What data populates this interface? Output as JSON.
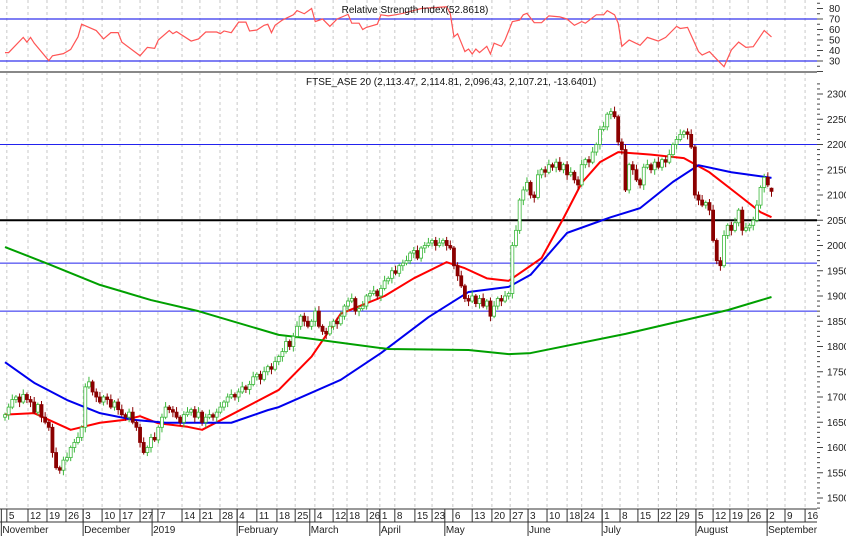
{
  "chart_data": {
    "type": "candlestick",
    "instrument_title": "FTSE_ASE 20 (2,113.47, 2,114.81, 2,096.43, 2,107.21, -13.6401)",
    "price": {
      "ylim": [
        1480,
        2330
      ],
      "yticks": [
        1500,
        1550,
        1600,
        1650,
        1700,
        1750,
        1800,
        1850,
        1900,
        1950,
        2000,
        2050,
        2100,
        2150,
        2200,
        2250,
        2300
      ],
      "closes": [
        1665,
        1680,
        1695,
        1700,
        1690,
        1705,
        1695,
        1690,
        1670,
        1685,
        1660,
        1650,
        1640,
        1590,
        1560,
        1555,
        1575,
        1580,
        1600,
        1610,
        1620,
        1640,
        1720,
        1730,
        1710,
        1700,
        1690,
        1700,
        1695,
        1680,
        1690,
        1675,
        1665,
        1660,
        1670,
        1650,
        1640,
        1610,
        1590,
        1600,
        1620,
        1615,
        1640,
        1660,
        1680,
        1675,
        1670,
        1660,
        1650,
        1665,
        1670,
        1675,
        1660,
        1670,
        1650,
        1660,
        1665,
        1660,
        1670,
        1680,
        1690,
        1700,
        1705,
        1700,
        1710,
        1720,
        1715,
        1725,
        1740,
        1745,
        1735,
        1750,
        1760,
        1755,
        1770,
        1780,
        1790,
        1810,
        1800,
        1820,
        1840,
        1860,
        1850,
        1840,
        1850,
        1870,
        1840,
        1830,
        1825,
        1840,
        1850,
        1845,
        1860,
        1880,
        1890,
        1895,
        1870,
        1875,
        1880,
        1900,
        1905,
        1910,
        1900,
        1915,
        1930,
        1935,
        1950,
        1945,
        1960,
        1965,
        1970,
        1985,
        1990,
        1975,
        1995,
        2000,
        2005,
        2010,
        2000,
        2005,
        2010,
        2000,
        1995,
        1960,
        1940,
        1920,
        1895,
        1890,
        1900,
        1885,
        1895,
        1880,
        1890,
        1860,
        1880,
        1895,
        1890,
        1900,
        1905,
        2000,
        2030,
        2090,
        2110,
        2125,
        2100,
        2095,
        2140,
        2150,
        2145,
        2160,
        2155,
        2165,
        2150,
        2160,
        2140,
        2145,
        2130,
        2120,
        2160,
        2170,
        2165,
        2185,
        2200,
        2230,
        2235,
        2260,
        2265,
        2255,
        2205,
        2190,
        2110,
        2160,
        2150,
        2130,
        2120,
        2155,
        2160,
        2150,
        2165,
        2155,
        2170,
        2165,
        2180,
        2200,
        2210,
        2220,
        2225,
        2220,
        2195,
        2100,
        2090,
        2080,
        2085,
        2070,
        2010,
        1970,
        1960,
        2020,
        2040,
        2030,
        2045,
        2070,
        2030,
        2035,
        2040,
        2050,
        2080,
        2115,
        2135,
        2120,
        2107.21
      ],
      "last_bar": {
        "open": 2113.47,
        "high": 2114.81,
        "low": 2096.43,
        "close": 2107.21,
        "change": -13.6401
      },
      "up_color": "#3cb83c",
      "down_color": "#8b0000"
    },
    "moving_averages": [
      {
        "name": "short-ma",
        "color": "#ff0000",
        "points": [
          [
            0,
            1665
          ],
          [
            8,
            1668
          ],
          [
            18,
            1635
          ],
          [
            26,
            1649
          ],
          [
            33,
            1655
          ],
          [
            37,
            1662
          ],
          [
            42,
            1648
          ],
          [
            50,
            1641
          ],
          [
            54,
            1635
          ],
          [
            62,
            1665
          ],
          [
            75,
            1714
          ],
          [
            84,
            1780
          ],
          [
            92,
            1865
          ],
          [
            104,
            1900
          ],
          [
            112,
            1935
          ],
          [
            121,
            1967
          ],
          [
            126,
            1955
          ],
          [
            132,
            1935
          ],
          [
            138,
            1930
          ],
          [
            147,
            1975
          ],
          [
            153,
            2054
          ],
          [
            158,
            2124
          ],
          [
            163,
            2165
          ],
          [
            168,
            2185
          ],
          [
            177,
            2180
          ],
          [
            186,
            2173
          ],
          [
            193,
            2145
          ],
          [
            201,
            2100
          ],
          [
            207,
            2066
          ],
          [
            210,
            2056
          ]
        ]
      },
      {
        "name": "medium-ma",
        "color": "#0000ee",
        "points": [
          [
            0,
            1769
          ],
          [
            8,
            1728
          ],
          [
            17,
            1694
          ],
          [
            26,
            1668
          ],
          [
            35,
            1655
          ],
          [
            44,
            1649
          ],
          [
            62,
            1649
          ],
          [
            72,
            1674
          ],
          [
            75,
            1680
          ],
          [
            92,
            1734
          ],
          [
            103,
            1787
          ],
          [
            116,
            1858
          ],
          [
            127,
            1908
          ],
          [
            138,
            1918
          ],
          [
            144,
            1942
          ],
          [
            154,
            2025
          ],
          [
            166,
            2056
          ],
          [
            174,
            2074
          ],
          [
            183,
            2126
          ],
          [
            190,
            2159
          ],
          [
            199,
            2145
          ],
          [
            210,
            2134
          ]
        ]
      },
      {
        "name": "long-ma",
        "color": "#00a000",
        "points": [
          [
            0,
            1997
          ],
          [
            12,
            1963
          ],
          [
            26,
            1922
          ],
          [
            40,
            1892
          ],
          [
            53,
            1870
          ],
          [
            75,
            1823
          ],
          [
            82,
            1817
          ],
          [
            105,
            1795
          ],
          [
            127,
            1793
          ],
          [
            138,
            1785
          ],
          [
            144,
            1787
          ],
          [
            170,
            1825
          ],
          [
            198,
            1872
          ],
          [
            210,
            1898
          ]
        ]
      }
    ],
    "hlines": [
      {
        "value": 2200,
        "color": "#2222ee"
      },
      {
        "value": 2050,
        "color": "#000000"
      },
      {
        "value": 1965,
        "color": "#2222ee"
      },
      {
        "value": 1870,
        "color": "#2222ee"
      }
    ],
    "rsi": {
      "title": "Relative Strength Index(52.8618)",
      "value": 52.8618,
      "ylim": [
        15,
        87
      ],
      "ticks": [
        30,
        40,
        50,
        60,
        70,
        80
      ],
      "levels": [
        70,
        30
      ],
      "color": "#ff5555",
      "points": [
        [
          0,
          38
        ],
        [
          1,
          38
        ],
        [
          5,
          52.5
        ],
        [
          6,
          48
        ],
        [
          7,
          52.5
        ],
        [
          8,
          47
        ],
        [
          12,
          30.3
        ],
        [
          13,
          35
        ],
        [
          16,
          37
        ],
        [
          18,
          41
        ],
        [
          20,
          53
        ],
        [
          21,
          65
        ],
        [
          25,
          59
        ],
        [
          27,
          51
        ],
        [
          29,
          57
        ],
        [
          31,
          57
        ],
        [
          32,
          48
        ],
        [
          37,
          35
        ],
        [
          39,
          43
        ],
        [
          41,
          42
        ],
        [
          42,
          50
        ],
        [
          45,
          59
        ],
        [
          46,
          56
        ],
        [
          47,
          58
        ],
        [
          51,
          49
        ],
        [
          53,
          51
        ],
        [
          55,
          57.6
        ],
        [
          58,
          57.6
        ],
        [
          59,
          56
        ],
        [
          60,
          58.6
        ],
        [
          62,
          57
        ],
        [
          64,
          67
        ],
        [
          66,
          67
        ],
        [
          67,
          58.6
        ],
        [
          69,
          59.5
        ],
        [
          71,
          64
        ],
        [
          72,
          65
        ],
        [
          73,
          57
        ],
        [
          74,
          64
        ],
        [
          76,
          69
        ],
        [
          79,
          74
        ],
        [
          80,
          78
        ],
        [
          82,
          75
        ],
        [
          84,
          80
        ],
        [
          85,
          67.5
        ],
        [
          87,
          70
        ],
        [
          89,
          63
        ],
        [
          91,
          70
        ],
        [
          94,
          74.4
        ],
        [
          95,
          66
        ],
        [
          97,
          66
        ],
        [
          98,
          60
        ],
        [
          99,
          62
        ],
        [
          102,
          65
        ],
        [
          103,
          74
        ],
        [
          105,
          73
        ],
        [
          107,
          74
        ],
        [
          109,
          75.4
        ],
        [
          113,
          79
        ],
        [
          114,
          80
        ],
        [
          121,
          81.7
        ],
        [
          122,
          75
        ],
        [
          123,
          53
        ],
        [
          124,
          56
        ],
        [
          126,
          39
        ],
        [
          127,
          41.4
        ],
        [
          128,
          36.7
        ],
        [
          129,
          41.4
        ],
        [
          130,
          38
        ],
        [
          132,
          44
        ],
        [
          133,
          36.7
        ],
        [
          134,
          47
        ],
        [
          136,
          44
        ],
        [
          137,
          50
        ],
        [
          139,
          67.5
        ],
        [
          141,
          69
        ],
        [
          142,
          74
        ],
        [
          143,
          75.4
        ],
        [
          145,
          66.5
        ],
        [
          147,
          66.5
        ],
        [
          149,
          73
        ],
        [
          152,
          72
        ],
        [
          154,
          70
        ],
        [
          156,
          64
        ],
        [
          158,
          67.5
        ],
        [
          159,
          66
        ],
        [
          162,
          74
        ],
        [
          164,
          74
        ],
        [
          165,
          78
        ],
        [
          167,
          74
        ],
        [
          168,
          66
        ],
        [
          169,
          44
        ],
        [
          171,
          50
        ],
        [
          174,
          45
        ],
        [
          176,
          52.5
        ],
        [
          179,
          49
        ],
        [
          181,
          52.5
        ],
        [
          184,
          63
        ],
        [
          185,
          61
        ],
        [
          187,
          62
        ],
        [
          190,
          39
        ],
        [
          191,
          35.7
        ],
        [
          193,
          39
        ],
        [
          195,
          31.6
        ],
        [
          197,
          24.6
        ],
        [
          199,
          40.5
        ],
        [
          201,
          48
        ],
        [
          203,
          43
        ],
        [
          205,
          43.6
        ],
        [
          208,
          59
        ],
        [
          210,
          52.9
        ]
      ]
    },
    "xaxis": {
      "ticks": [
        {
          "label": "5",
          "i": 0.5
        },
        {
          "label": "12",
          "i": 6.3
        },
        {
          "label": "19",
          "i": 11.5
        },
        {
          "label": "26",
          "i": 16.7
        },
        {
          "label": "3",
          "i": 21.4
        },
        {
          "label": "10",
          "i": 26.6
        },
        {
          "label": "17",
          "i": 31.5
        },
        {
          "label": "27",
          "i": 37
        },
        {
          "label": "7",
          "i": 41.9
        },
        {
          "label": "14",
          "i": 48.5
        },
        {
          "label": "21",
          "i": 53.4
        },
        {
          "label": "28",
          "i": 58.9
        },
        {
          "label": "4",
          "i": 63.6
        },
        {
          "label": "11",
          "i": 69
        },
        {
          "label": "18",
          "i": 74.5
        },
        {
          "label": "25",
          "i": 79.5
        },
        {
          "label": "4",
          "i": 84.9
        },
        {
          "label": "12",
          "i": 89.9
        },
        {
          "label": "18",
          "i": 93.7
        },
        {
          "label": "26",
          "i": 99.2
        },
        {
          "label": "1",
          "i": 102.7
        },
        {
          "label": "8",
          "i": 106.8
        },
        {
          "label": "15",
          "i": 112.3
        },
        {
          "label": "23",
          "i": 117
        },
        {
          "label": "6",
          "i": 122.7
        },
        {
          "label": "13",
          "i": 128
        },
        {
          "label": "20",
          "i": 133.4
        },
        {
          "label": "27",
          "i": 138.4
        },
        {
          "label": "3",
          "i": 143.3
        },
        {
          "label": "10",
          "i": 148.5
        },
        {
          "label": "18",
          "i": 154
        },
        {
          "label": "24",
          "i": 158
        },
        {
          "label": "1",
          "i": 163.6
        },
        {
          "label": "8",
          "i": 168.5
        },
        {
          "label": "15",
          "i": 173.4
        },
        {
          "label": "22",
          "i": 179
        },
        {
          "label": "29",
          "i": 184
        },
        {
          "label": "5",
          "i": 189.3
        },
        {
          "label": "12",
          "i": 194
        },
        {
          "label": "19",
          "i": 198.6
        },
        {
          "label": "26",
          "i": 203.6
        },
        {
          "label": "2",
          "i": 208.8
        },
        {
          "label": "9",
          "i": 213.7
        },
        {
          "label": "16",
          "i": 219.2
        }
      ],
      "months": [
        {
          "label": "November",
          "i": -1
        },
        {
          "label": "December",
          "i": 21.4
        },
        {
          "label": "2019",
          "i": 40.3
        },
        {
          "label": "February",
          "i": 63.6
        },
        {
          "label": "March",
          "i": 83.5
        },
        {
          "label": "April",
          "i": 102.7
        },
        {
          "label": "May",
          "i": 120.5
        },
        {
          "label": "June",
          "i": 143.3
        },
        {
          "label": "July",
          "i": 163.6
        },
        {
          "label": "August",
          "i": 189.3
        },
        {
          "label": "September",
          "i": 208.8
        }
      ]
    }
  }
}
